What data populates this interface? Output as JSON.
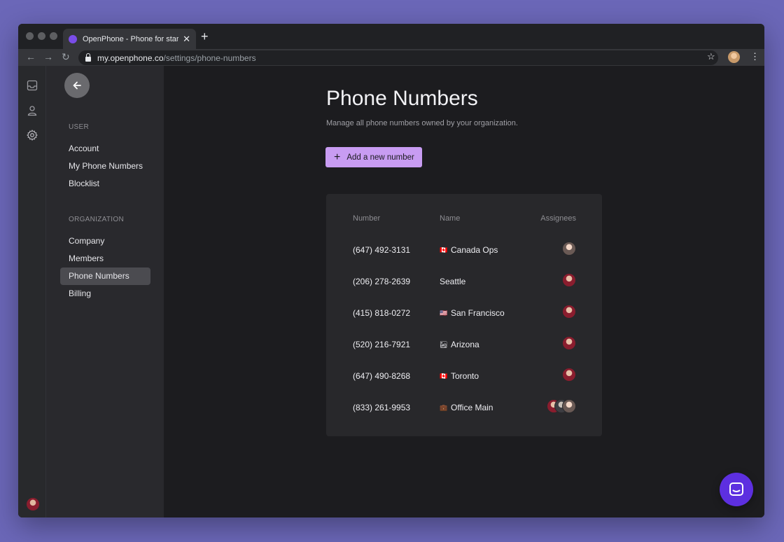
{
  "browser": {
    "tab_title": "OpenPhone - Phone for startups",
    "url_host": "my.openphone.co",
    "url_path": "/settings/phone-numbers"
  },
  "sidebar": {
    "user_section": "USER",
    "user_items": [
      "Account",
      "My Phone Numbers",
      "Blocklist"
    ],
    "org_section": "ORGANIZATION",
    "org_items": [
      "Company",
      "Members",
      "Phone Numbers",
      "Billing"
    ],
    "active_item": "Phone Numbers"
  },
  "page": {
    "title": "Phone Numbers",
    "subtitle": "Manage all phone numbers owned by your organization.",
    "add_button_label": "Add a new number"
  },
  "table": {
    "headers": {
      "number": "Number",
      "name": "Name",
      "assignees": "Assignees"
    },
    "rows": [
      {
        "number": "(647) 492-3131",
        "name": "Canada Ops",
        "flag": "🇨🇦",
        "assignees": [
          "light"
        ]
      },
      {
        "number": "(206) 278-2639",
        "name": "Seattle",
        "flag": "",
        "assignees": [
          "red"
        ]
      },
      {
        "number": "(415) 818-0272",
        "name": "San Francisco",
        "flag": "🇺🇸",
        "assignees": [
          "red"
        ]
      },
      {
        "number": "(520) 216-7921",
        "name": "Arizona",
        "flag": "🏜",
        "assignees": [
          "red"
        ]
      },
      {
        "number": "(647) 490-8268",
        "name": "Toronto",
        "flag": "🇨🇦",
        "assignees": [
          "red"
        ]
      },
      {
        "number": "(833) 261-9953",
        "name": "Office Main",
        "flag": "💼",
        "assignees": [
          "red",
          "grey",
          "light"
        ]
      }
    ]
  }
}
